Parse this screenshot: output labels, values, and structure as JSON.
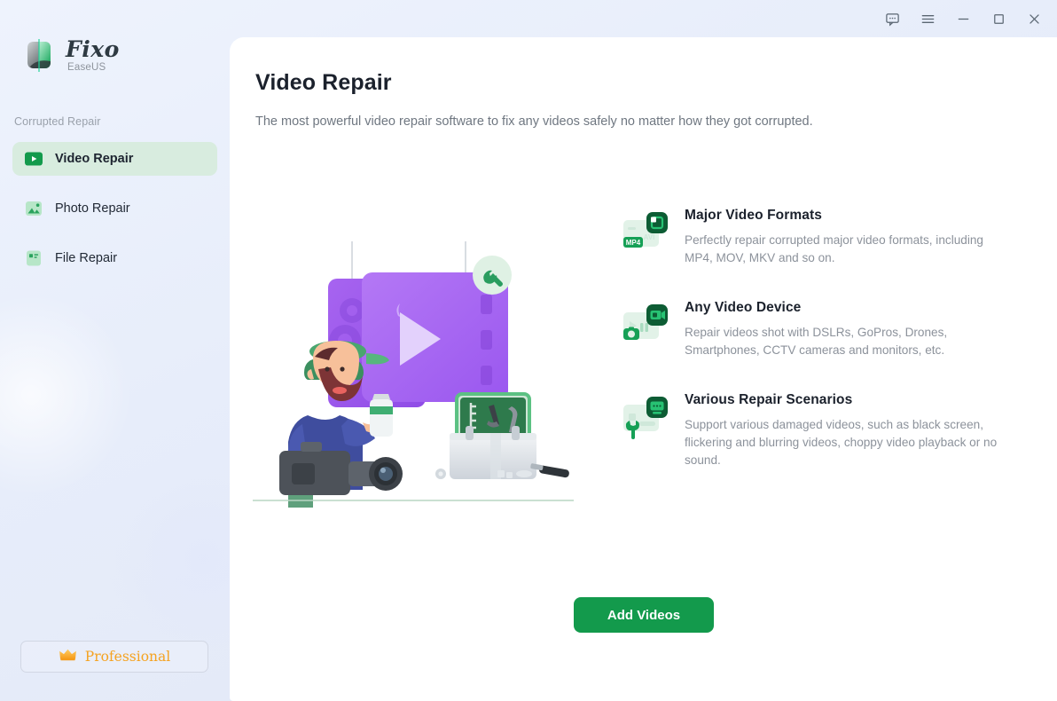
{
  "window": {
    "controls": [
      {
        "name": "feedback",
        "label": "Feedback"
      },
      {
        "name": "menu",
        "label": "Menu"
      },
      {
        "name": "minimize",
        "label": "Minimize"
      },
      {
        "name": "maximize",
        "label": "Maximize"
      },
      {
        "name": "close",
        "label": "Close"
      }
    ]
  },
  "sidebar": {
    "logo": {
      "title": "Fixo",
      "subtitle": "EaseUS"
    },
    "section_label": "Corrupted Repair",
    "items": [
      {
        "label": "Video Repair",
        "icon": "video-play-icon",
        "active": true
      },
      {
        "label": "Photo Repair",
        "icon": "photo-icon",
        "active": false
      },
      {
        "label": "File Repair",
        "icon": "file-icon",
        "active": false
      }
    ],
    "pro_button": {
      "label": "Professional",
      "icon": "crown-icon"
    }
  },
  "main": {
    "title": "Video Repair",
    "subtitle": "The most powerful video repair software to fix any videos safely no matter how they got corrupted.",
    "illustration": {
      "name": "videographer-video-repair-illustration",
      "labels": {
        "avi": "AVI",
        "mp4": "MP4"
      }
    },
    "features": [
      {
        "icon": "video-formats-icon",
        "title": "Major Video Formats",
        "description": "Perfectly repair corrupted major video formats, including MP4, MOV, MKV and so on."
      },
      {
        "icon": "video-device-icon",
        "title": "Any Video Device",
        "description": "Repair videos shot with DSLRs, GoPros, Drones, Smartphones, CCTV cameras and monitors, etc."
      },
      {
        "icon": "repair-scenarios-icon",
        "title": "Various Repair Scenarios",
        "description": "Support various damaged videos, such as black screen, flickering and blurring videos, choppy video playback or no sound."
      }
    ],
    "primary_action": {
      "label": "Add Videos"
    }
  },
  "colors": {
    "accent_green": "#139a4c",
    "accent_green_dark": "#0d5c34",
    "active_item_bg": "#d8ecdf",
    "pro_orange": "#f5a220",
    "sidebar_bg": "#e7edfa",
    "panel_bg": "#ffffff"
  },
  "icon_labels": {
    "avi_tag": "AVI",
    "mp4_tag": "MP4"
  }
}
